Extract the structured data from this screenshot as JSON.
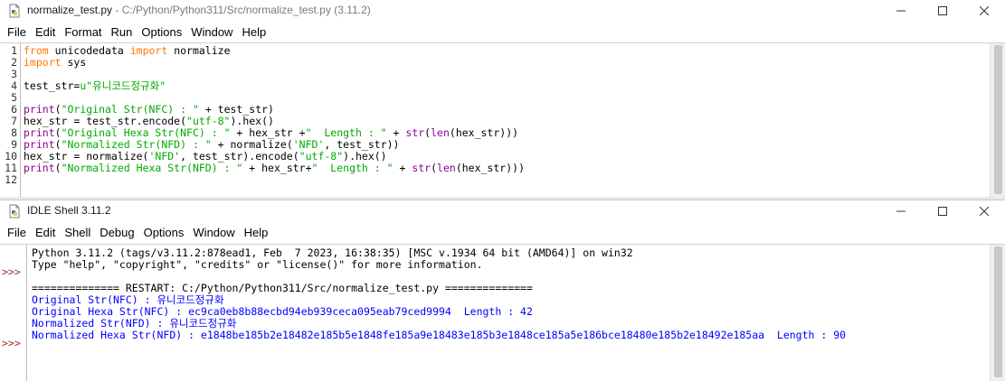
{
  "editor": {
    "title_main": "normalize_test.py",
    "title_sep": " - ",
    "title_path": "C:/Python/Python311/Src/normalize_test.py (3.11.2)",
    "menu": [
      "File",
      "Edit",
      "Format",
      "Run",
      "Options",
      "Window",
      "Help"
    ],
    "line_numbers": [
      "1",
      "2",
      "3",
      "4",
      "5",
      "6",
      "7",
      "8",
      "9",
      "10",
      "11",
      "12"
    ],
    "lines": [
      [
        {
          "t": "from",
          "c": "kw"
        },
        {
          "t": " unicodedata ",
          "c": ""
        },
        {
          "t": "import",
          "c": "kw"
        },
        {
          "t": " normalize",
          "c": ""
        }
      ],
      [
        {
          "t": "import",
          "c": "kw"
        },
        {
          "t": " sys",
          "c": ""
        }
      ],
      [],
      [
        {
          "t": "test_str=",
          "c": ""
        },
        {
          "t": "u\"유니코드정규화\"",
          "c": "st"
        }
      ],
      [],
      [
        {
          "t": "print",
          "c": "bi"
        },
        {
          "t": "(",
          "c": ""
        },
        {
          "t": "\"Original Str(NFC) : \"",
          "c": "st"
        },
        {
          "t": " + test_str)",
          "c": ""
        }
      ],
      [
        {
          "t": "hex_str = test_str.encode(",
          "c": ""
        },
        {
          "t": "\"utf-8\"",
          "c": "st"
        },
        {
          "t": ").hex()",
          "c": ""
        }
      ],
      [
        {
          "t": "print",
          "c": "bi"
        },
        {
          "t": "(",
          "c": ""
        },
        {
          "t": "\"Original Hexa Str(NFC) : \"",
          "c": "st"
        },
        {
          "t": " + hex_str +",
          "c": ""
        },
        {
          "t": "\"  Length : \"",
          "c": "st"
        },
        {
          "t": " + ",
          "c": ""
        },
        {
          "t": "str",
          "c": "bi"
        },
        {
          "t": "(",
          "c": ""
        },
        {
          "t": "len",
          "c": "bi"
        },
        {
          "t": "(hex_str)))",
          "c": ""
        }
      ],
      [
        {
          "t": "print",
          "c": "bi"
        },
        {
          "t": "(",
          "c": ""
        },
        {
          "t": "\"Normalized Str(NFD) : \"",
          "c": "st"
        },
        {
          "t": " + normalize(",
          "c": ""
        },
        {
          "t": "'NFD'",
          "c": "st"
        },
        {
          "t": ", test_str))",
          "c": ""
        }
      ],
      [
        {
          "t": "hex_str = normalize(",
          "c": ""
        },
        {
          "t": "'NFD'",
          "c": "st"
        },
        {
          "t": ", test_str).encode(",
          "c": ""
        },
        {
          "t": "\"utf-8\"",
          "c": "st"
        },
        {
          "t": ").hex()",
          "c": ""
        }
      ],
      [
        {
          "t": "print",
          "c": "bi"
        },
        {
          "t": "(",
          "c": ""
        },
        {
          "t": "\"Normalized Hexa Str(NFD) : \"",
          "c": "st"
        },
        {
          "t": " + hex_str+",
          "c": ""
        },
        {
          "t": "\"  Length : \"",
          "c": "st"
        },
        {
          "t": " + ",
          "c": ""
        },
        {
          "t": "str",
          "c": "bi"
        },
        {
          "t": "(",
          "c": ""
        },
        {
          "t": "len",
          "c": "bi"
        },
        {
          "t": "(hex_str)))",
          "c": ""
        }
      ],
      []
    ]
  },
  "shell": {
    "title": "IDLE Shell 3.11.2",
    "menu": [
      "File",
      "Edit",
      "Shell",
      "Debug",
      "Options",
      "Window",
      "Help"
    ],
    "prompt": ">>>",
    "lines": [
      {
        "t": "Python 3.11.2 (tags/v3.11.2:878ead1, Feb  7 2023, 16:38:35) [MSC v.1934 64 bit (AMD64)] on win32",
        "c": ""
      },
      {
        "t": "Type \"help\", \"copyright\", \"credits\" or \"license()\" for more information.",
        "c": ""
      },
      {
        "t": "",
        "c": ""
      },
      {
        "t": "============== RESTART: C:/Python/Python311/Src/normalize_test.py ==============",
        "c": ""
      },
      {
        "t": "Original Str(NFC) : 유니코드정규화",
        "c": "so"
      },
      {
        "t": "Original Hexa Str(NFC) : ec9ca0eb8b88ecbd94eb939ceca095eab79ced9994  Length : 42",
        "c": "so"
      },
      {
        "t": "Normalized Str(NFD) : 유니코드정규화",
        "c": "so"
      },
      {
        "t": "Normalized Hexa Str(NFD) : e1848be185b2e18482e185b5e1848fe185a9e18483e185b3e1848ce185a5e186bce18480e185b2e18492e185aa  Length : 90",
        "c": "so"
      }
    ]
  },
  "colors": {
    "keyword": "#ff7700",
    "string": "#00aa00",
    "builtin": "#900090",
    "stdout": "#0000ff",
    "prompt": "#a52a2a"
  },
  "icons": [
    "python-idle-icon",
    "minimize-icon",
    "maximize-icon",
    "close-icon"
  ]
}
